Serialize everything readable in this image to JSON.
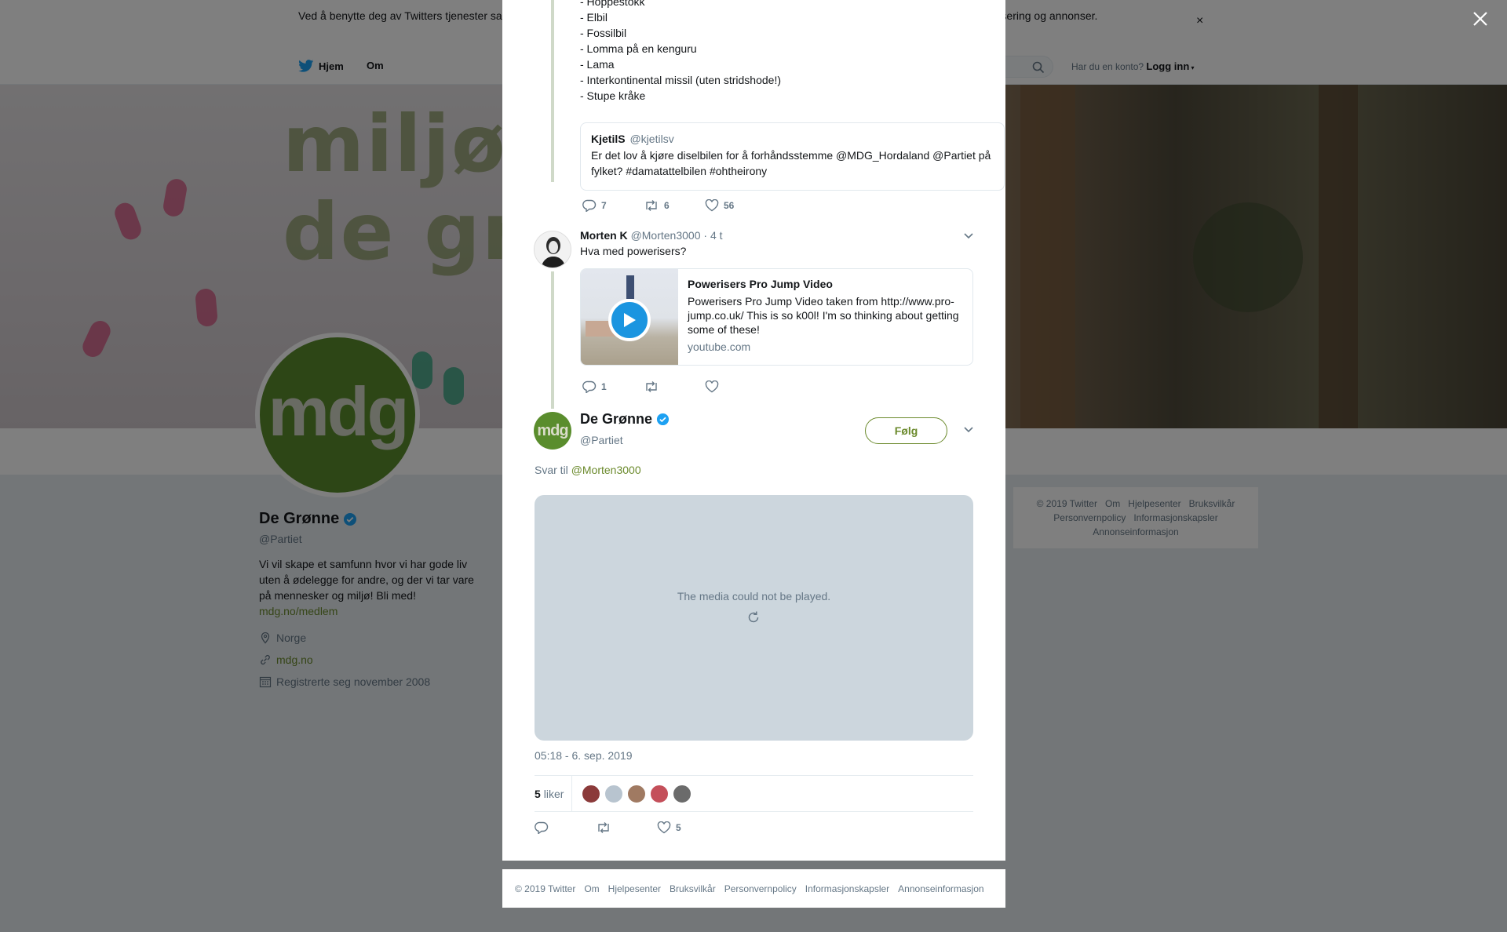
{
  "cookie_bar": {
    "text": "Ved å benytte deg av Twitters tjenester samtykker du til at vi og samarbeidspartnerne våre bruker informasjonskapsler til bl.a. analyser, personalisering og annonser.",
    "close": "×"
  },
  "topnav": {
    "home": "Hjem",
    "about": "Om",
    "account_question": "Har du en konto?",
    "login": "Logg inn"
  },
  "banner": {
    "line1": "miljøpa",
    "line2": "de grø"
  },
  "profile": {
    "avatar_text": "mdg",
    "name": "De Grønne",
    "handle": "@Partiet",
    "bio": "Vi vil skape et samfunn hvor vi har gode liv uten å ødelegge for andre, og der vi tar vare på mennesker og miljø! Bli med!",
    "bio_link": "mdg.no/medlem",
    "location": "Norge",
    "website": "mdg.no",
    "joined": "Registrerte seg november 2008"
  },
  "side_footer": {
    "links": [
      "© 2019 Twitter",
      "Om",
      "Hjelpesenter",
      "Bruksvilkår",
      "Personvernpolicy",
      "Informasjonskapsler",
      "Annonseinformasjon"
    ]
  },
  "thread": {
    "prev_list": [
      "- Hoppestokk",
      "- Elbil",
      "- Fossilbil",
      "- Lomma på en kenguru",
      "- Lama",
      "- Interkontinental missil (uten stridshode!)",
      "- Stupe kråke"
    ],
    "quote": {
      "name": "KjetilS",
      "handle": "@kjetilsv",
      "text": "Er det lov å kjøre diselbilen for å forhåndsstemme @MDG_Hordaland @Partiet på fylket? #damatattelbilen #ohtheirony"
    },
    "prev_actions": {
      "replies": "7",
      "retweets": "6",
      "likes": "56"
    },
    "reply": {
      "name": "Morten K",
      "handle": "@Morten3000",
      "time": "· 4 t",
      "text": "Hva med powerisers?",
      "card": {
        "title": "Powerisers Pro Jump Video",
        "description": "Powerisers Pro Jump Video taken from http://www.pro-jump.co.uk/ This is so k00l! I'm so thinking about getting some of these!",
        "domain": "youtube.com"
      },
      "actions": {
        "replies": "1"
      }
    }
  },
  "main_tweet": {
    "avatar_text": "mdg",
    "name": "De Grønne",
    "handle": "@Partiet",
    "follow_label": "Følg",
    "reply_to_label": "Svar til",
    "reply_to_handle": "@Morten3000",
    "media_message": "The media could not be played.",
    "timestamp": "05:18 - 6. sep. 2019",
    "likes_count": "5",
    "likes_label": "liker",
    "like_action_count": "5",
    "liker_colors": [
      "#8b3a3a",
      "#b8c4cf",
      "#a07a62",
      "#c44f5a",
      "#6b6b6b"
    ]
  },
  "modal_footer": {
    "links": [
      "© 2019 Twitter",
      "Om",
      "Hjelpesenter",
      "Bruksvilkår",
      "Personvernpolicy",
      "Informasjonskapsler",
      "Annonseinformasjon"
    ]
  },
  "colors": {
    "brand_green": "#6b8a2c",
    "avatar_green": "#5a8d2d",
    "twitter_blue": "#1da1f2",
    "muted": "#657786"
  }
}
